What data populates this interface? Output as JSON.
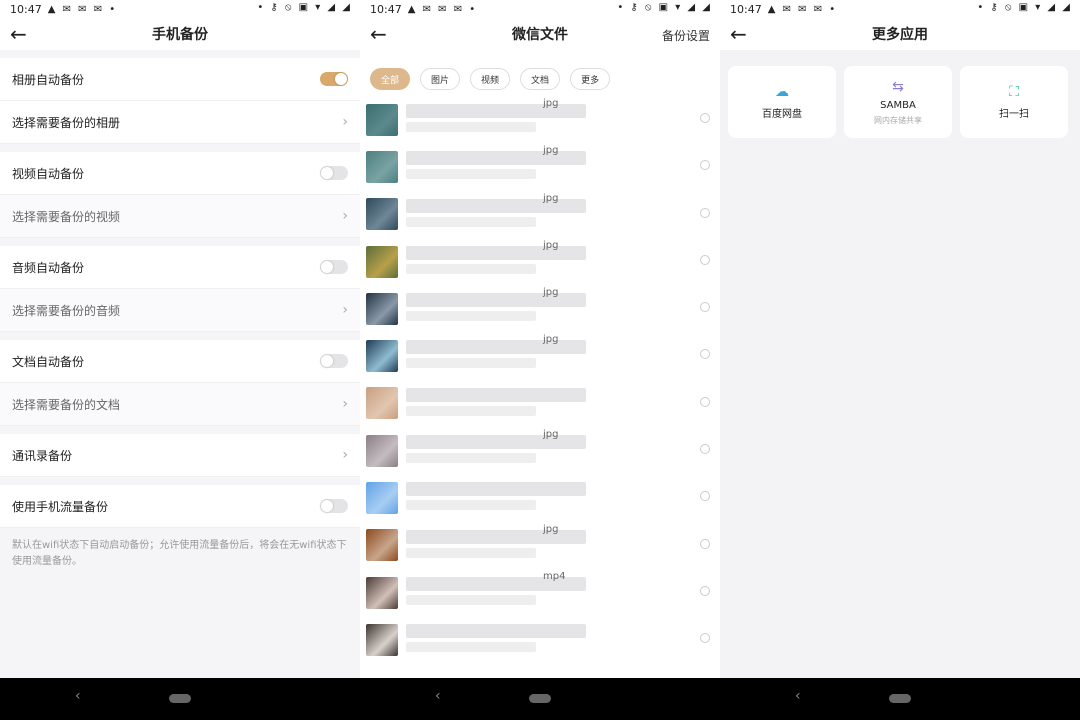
{
  "status": {
    "time": "10:47",
    "notifs": "▲ ✉ ✉ ✉ •",
    "right": "• ⚷ ⦸ ▣ ▾ ◢ ◢"
  },
  "screen1": {
    "title": "手机备份",
    "rows": {
      "photo_auto": "相册自动备份",
      "photo_select": "选择需要备份的相册",
      "video_auto": "视频自动备份",
      "video_select": "选择需要备份的视频",
      "audio_auto": "音频自动备份",
      "audio_select": "选择需要备份的音频",
      "doc_auto": "文档自动备份",
      "doc_select": "选择需要备份的文档",
      "contacts": "通讯录备份",
      "mobile_data": "使用手机流量备份"
    },
    "note": "默认在wifi状态下自动启动备份；允许使用流量备份后，将会在无wifi状态下使用流量备份。"
  },
  "screen2": {
    "title": "微信文件",
    "action": "备份设置",
    "chips": [
      "全部",
      "图片",
      "视频",
      "文档",
      "更多"
    ],
    "files": [
      {
        "ext": "jpg",
        "colors": [
          "#3c6d6f",
          "#5c8a8c"
        ]
      },
      {
        "ext": "jpg",
        "colors": [
          "#4d7f80",
          "#7aa3a3"
        ]
      },
      {
        "ext": "jpg",
        "colors": [
          "#2e4a5c",
          "#6f8796"
        ]
      },
      {
        "ext": "jpg",
        "colors": [
          "#5b6e3a",
          "#b8a04a"
        ]
      },
      {
        "ext": "jpg",
        "colors": [
          "#223344",
          "#8a99a8"
        ]
      },
      {
        "ext": "jpg",
        "colors": [
          "#1f3b55",
          "#8fbcd0"
        ]
      },
      {
        "ext": "",
        "colors": [
          "#c89f7f",
          "#e2c6b0"
        ]
      },
      {
        "ext": "jpg",
        "colors": [
          "#8a7f86",
          "#c4bcc0"
        ]
      },
      {
        "ext": "",
        "colors": [
          "#5fa3e8",
          "#a9cdf2"
        ]
      },
      {
        "ext": "jpg",
        "colors": [
          "#8c4a20",
          "#c8a58a"
        ]
      },
      {
        "ext": "mp4",
        "colors": [
          "#4a3b34",
          "#d0c0b8"
        ]
      },
      {
        "ext": "",
        "colors": [
          "#3a3330",
          "#d9d2cc"
        ]
      }
    ]
  },
  "screen3": {
    "title": "更多应用",
    "cards": [
      {
        "label": "百度网盘",
        "sub": ""
      },
      {
        "label": "SAMBA",
        "sub": "网内存储共享"
      },
      {
        "label": "扫一扫",
        "sub": ""
      }
    ]
  },
  "colors": {
    "accent": "#deb88d",
    "toggle_on": "#d9a86a"
  },
  "icons": {
    "back": "back-arrow-icon",
    "chevron": "chevron-right-icon"
  }
}
